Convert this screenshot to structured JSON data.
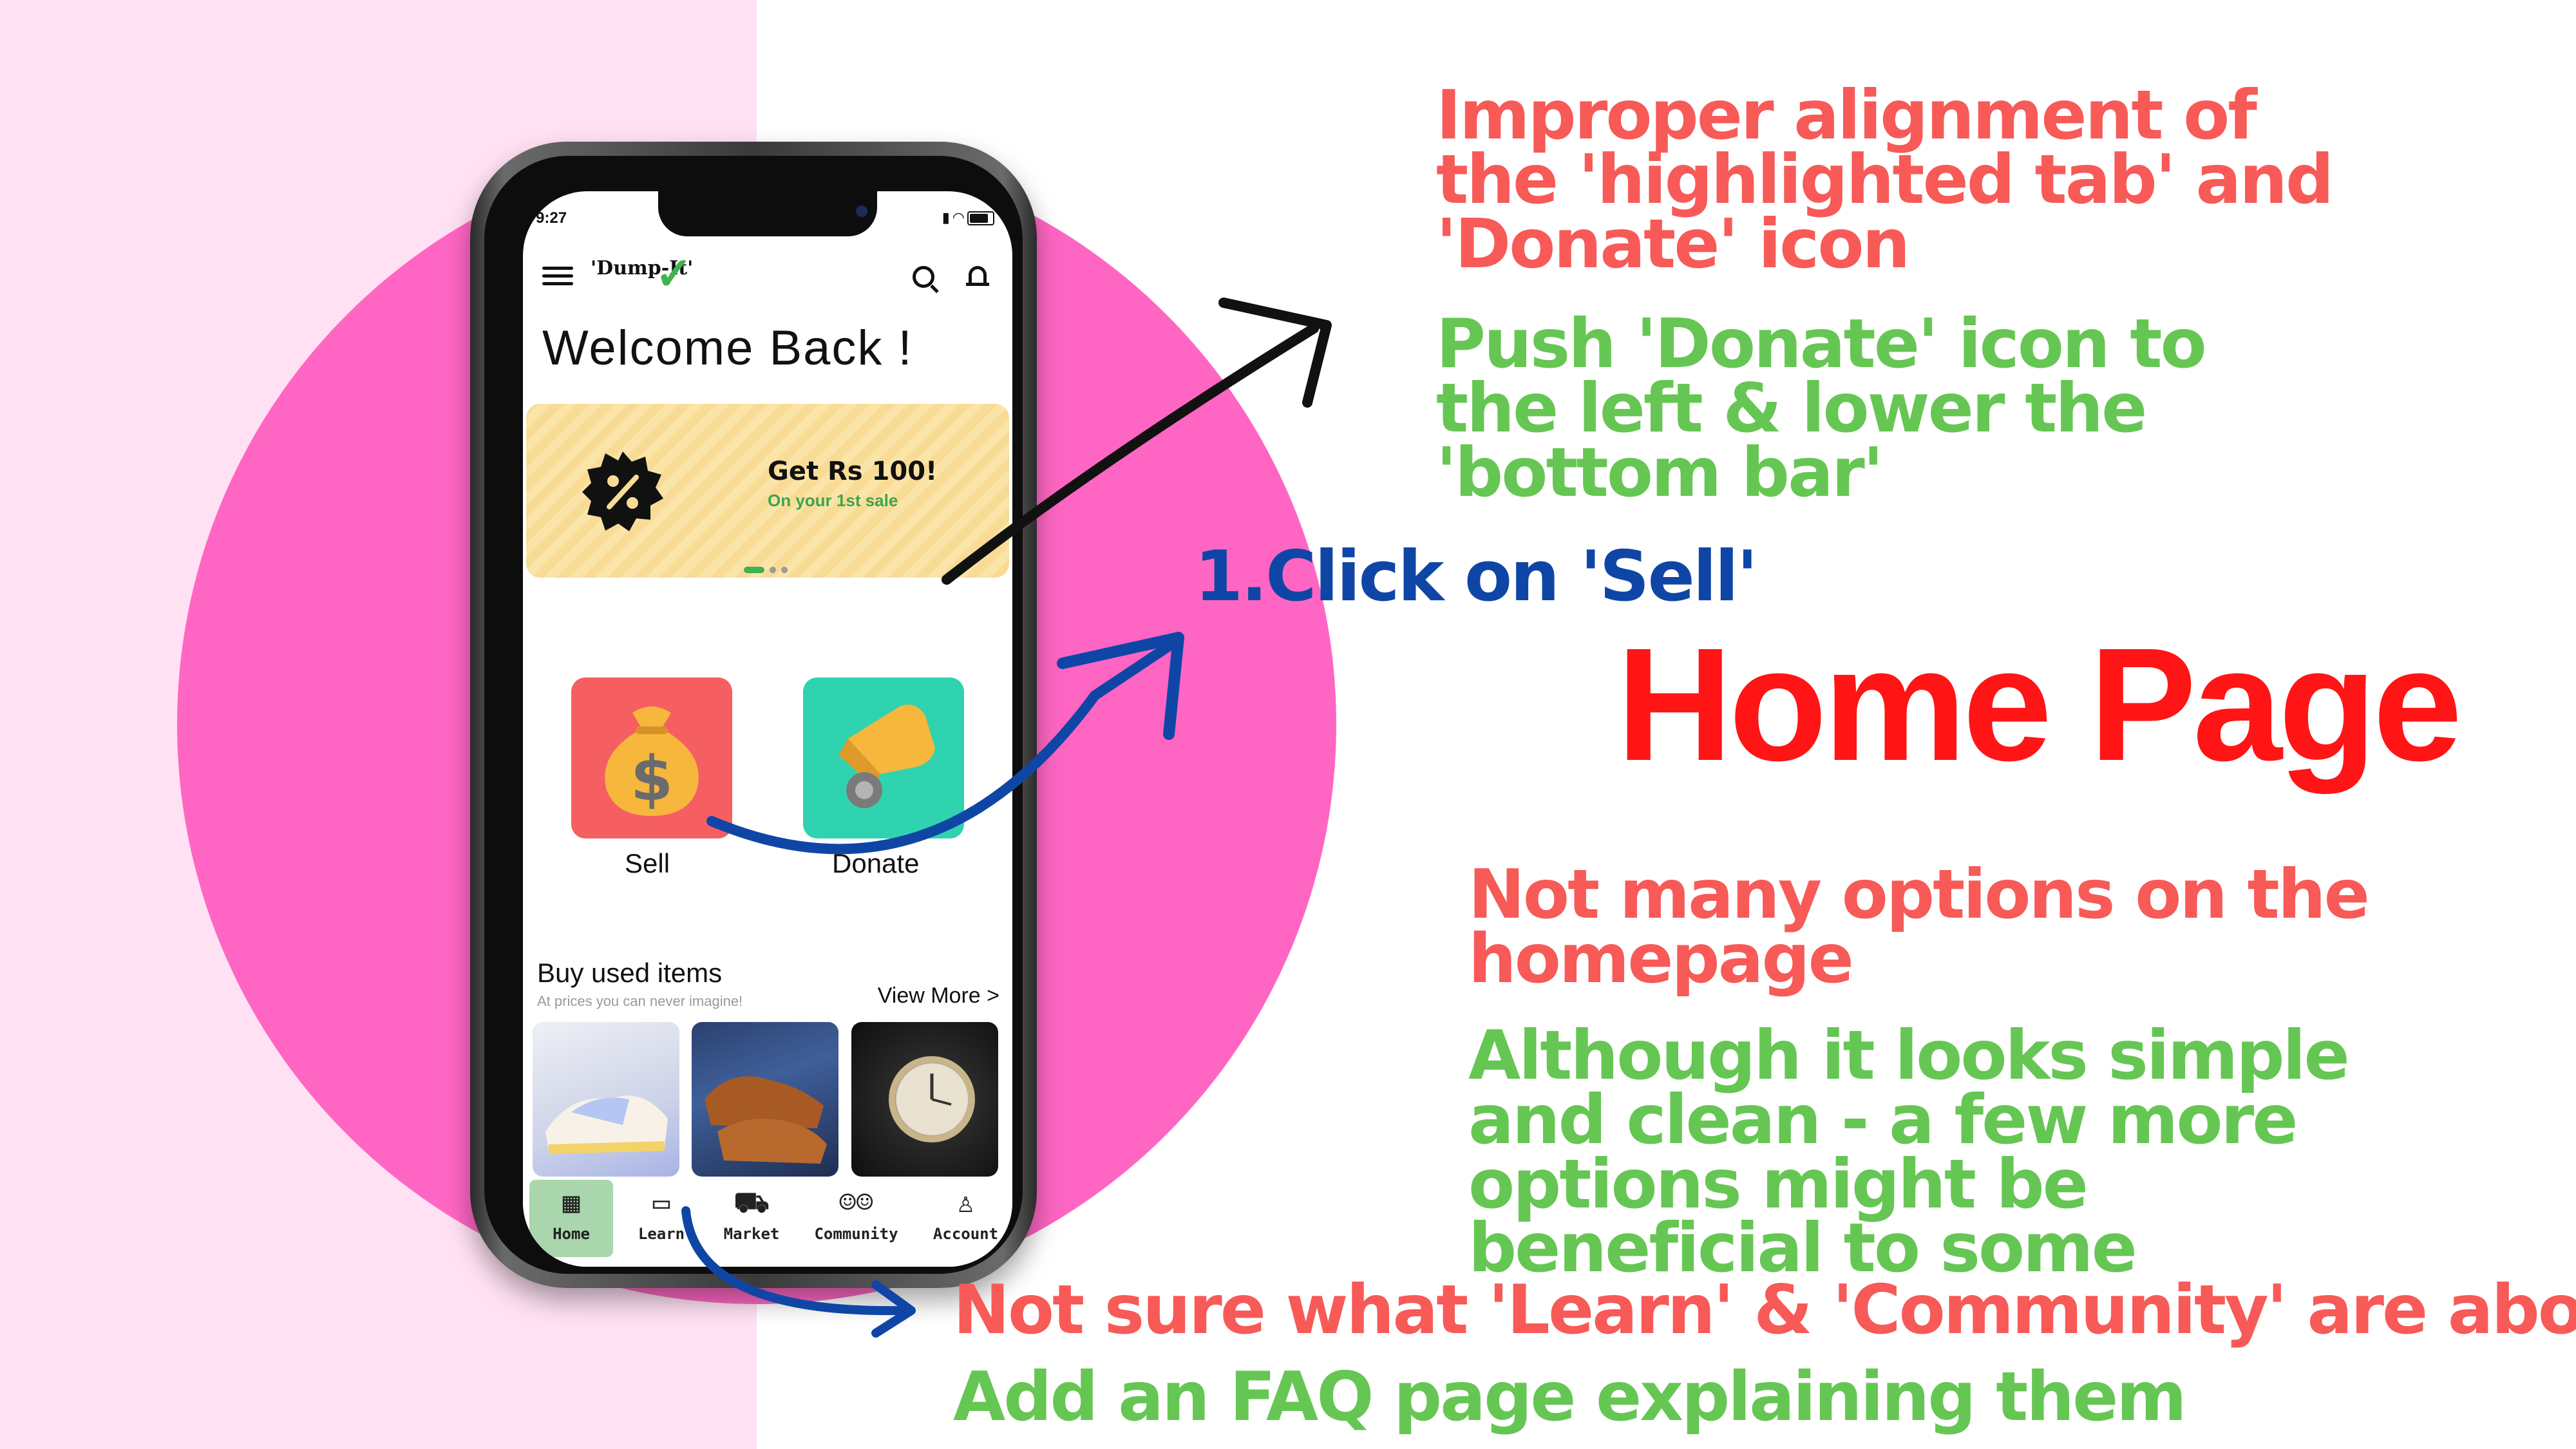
{
  "phone": {
    "status": {
      "time": "9:27"
    },
    "header": {
      "logo": "'Dump-It'"
    },
    "welcome": "Welcome Back !",
    "banner": {
      "title": "Get Rs 100!",
      "subtitle": "On your 1st sale"
    },
    "actions": {
      "sell": "Sell",
      "donate": "Donate"
    },
    "buy_section": {
      "title": "Buy used items",
      "subtitle": "At prices you can never imagine!",
      "view_more": "View More >"
    },
    "nav": [
      {
        "label": "Home",
        "icon": "store-icon",
        "active": true
      },
      {
        "label": "Learn",
        "icon": "book-icon"
      },
      {
        "label": "Market",
        "icon": "cart-icon"
      },
      {
        "label": "Community",
        "icon": "people-icon"
      },
      {
        "label": "Account",
        "icon": "user-icon"
      }
    ]
  },
  "annotations": {
    "note1": "Improper alignment of the 'highlighted tab' and 'Donate' icon",
    "note2": "Push 'Donate' icon to the left & lower the 'bottom bar'",
    "step": "1.Click on 'Sell'",
    "title": "Home Page",
    "note3": "Not many options on the homepage",
    "note4": "Although it looks simple and clean - a few more options might be beneficial to some",
    "note5": "Not sure what 'Learn' & 'Community' are about",
    "note6": "Add an FAQ page explaining them"
  },
  "colors": {
    "pink_bg": "#ffe1f3",
    "pink_circle": "#ff66c4",
    "note_red": "#f75a57",
    "note_green": "#66c653",
    "step_blue": "#0f46a6",
    "title_red": "#ff1515"
  }
}
